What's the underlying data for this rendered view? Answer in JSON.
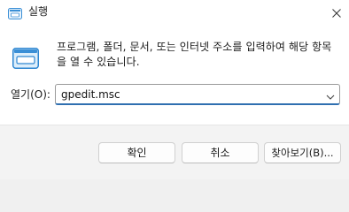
{
  "window": {
    "title": "실행",
    "title_icon": "run-dialog-icon",
    "close_icon": "close-icon"
  },
  "main": {
    "icon": "run-dialog-icon",
    "message": "프로그램, 폴더, 문서, 또는 인터넷 주소를 입력하여 해당 항목을 열 수 있습니다."
  },
  "open": {
    "label": "열기(O):",
    "value": "gpedit.msc",
    "dropdown_icon": "chevron-down-icon"
  },
  "buttons": {
    "ok": "확인",
    "cancel": "취소",
    "browse": "찾아보기(B)..."
  },
  "colors": {
    "accent": "#2f6fb0",
    "icon_blue": "#3a8fd6",
    "footer_bg": "#f3f3f3"
  }
}
